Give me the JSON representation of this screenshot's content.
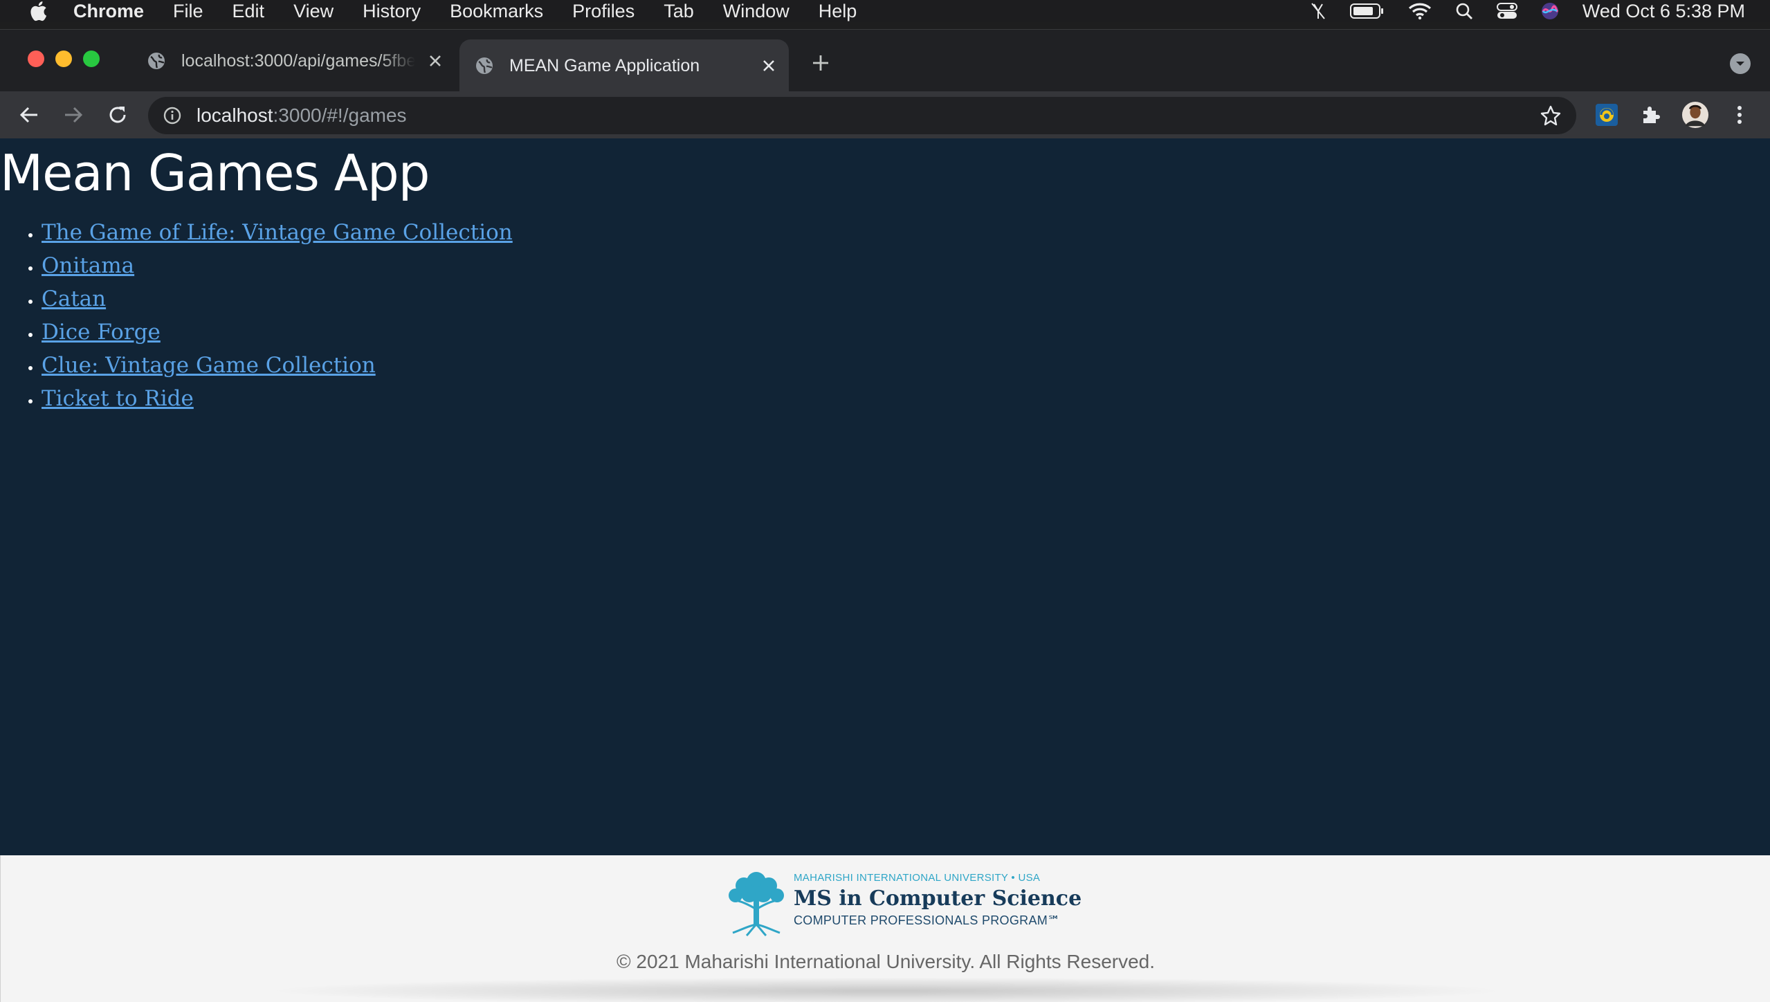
{
  "menubar": {
    "app_name": "Chrome",
    "items": [
      "File",
      "Edit",
      "View",
      "History",
      "Bookmarks",
      "Profiles",
      "Tab",
      "Window",
      "Help"
    ],
    "clock": "Wed Oct 6  5:38 PM"
  },
  "tabs": [
    {
      "title": "localhost:3000/api/games/5fbe",
      "active": false
    },
    {
      "title": "MEAN Game Application",
      "active": true
    }
  ],
  "address_bar": {
    "host": "localhost",
    "path": ":3000/#!/games"
  },
  "page": {
    "heading": "Mean Games App",
    "games": [
      "The Game of Life: Vintage Game Collection",
      "Onitama",
      "Catan",
      "Dice Forge",
      "Clue: Vintage Game Collection",
      "Ticket to Ride"
    ]
  },
  "footer": {
    "logo_line1": "MAHARISHI INTERNATIONAL UNIVERSITY • USA",
    "logo_line2": "MS in Computer Science",
    "logo_line3": "COMPUTER PROFESSIONALS PROGRAM℠",
    "copyright": "© 2021 Maharishi International University. All Rights Reserved."
  },
  "colors": {
    "page_background": "#112436",
    "link": "#5aa2e6",
    "footer_background": "#f4f4f4"
  }
}
